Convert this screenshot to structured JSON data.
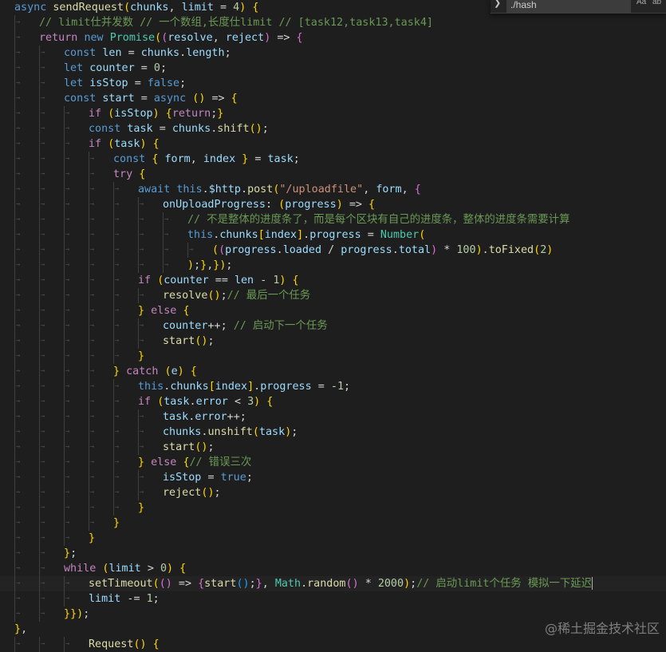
{
  "search": {
    "toggle_icon": "chevron-right-icon",
    "value": "./hash",
    "match_case_label": "Aa",
    "whole_word_label": "ab"
  },
  "watermark": "@稀土掘金技术社区",
  "colors": {
    "background": "#1e1e1e",
    "keyword": "#569cd6",
    "control": "#c586c0",
    "function": "#dcdcaa",
    "variable": "#9cdcfe",
    "class": "#4ec9b0",
    "string": "#ce9178",
    "number": "#b5cea8",
    "comment": "#6a9955"
  },
  "code_lines": [
    "async sendRequest(chunks, limit = 4) {",
    "  // limit仕并发数 // 一个数组,长度仕limit // [task12,task13,task4]",
    "  return new Promise((resolve, reject) => {",
    "    const len = chunks.length;",
    "    let counter = 0;",
    "    let isStop = false;",
    "    const start = async () => {",
    "      if (isStop) {return;}",
    "      const task = chunks.shift();",
    "      if (task) {",
    "        const { form, index } = task;",
    "        try {",
    "          await this.$http.post(\"/uploadfile\", form, {",
    "            onUploadProgress: (progress) => {",
    "              // 不是整体的进度条了，而是每个区块有自己的进度条，整体的进度条需要计算",
    "              this.chunks[index].progress = Number(",
    "                ((progress.loaded / progress.total) * 100).toFixed(2)",
    "              );},});",
    "          if (counter == len - 1) {",
    "            resolve();// 最后一个任务",
    "          } else {",
    "            counter++; // 启动下一个任务",
    "            start();",
    "          }",
    "        } catch (e) {",
    "          this.chunks[index].progress = -1;",
    "          if (task.error < 3) {",
    "            task.error++;",
    "            chunks.unshift(task);",
    "            start();",
    "          } else {// 错误三次",
    "            isStop = true;",
    "            reject();",
    "          }",
    "        }",
    "      }",
    "    };",
    "    while (limit > 0) {",
    "      setTimeout(() => {start();}, Math.random() * 2000);// 启动limit个任务 模拟一下延迟",
    "      limit -= 1;",
    "    }});",
    "},",
    "      Request() {"
  ]
}
